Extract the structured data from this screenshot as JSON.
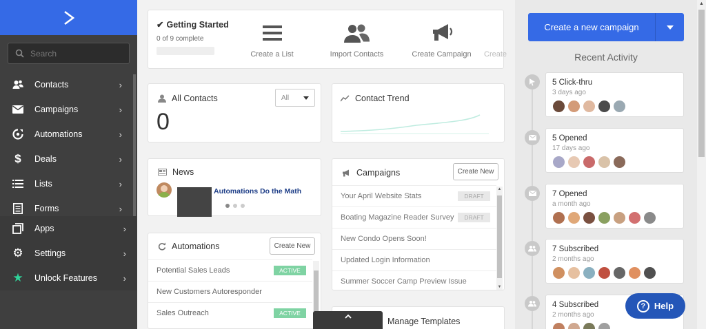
{
  "sidebar": {
    "search_placeholder": "Search",
    "nav": [
      {
        "label": "Contacts",
        "icon": "contacts-icon"
      },
      {
        "label": "Campaigns",
        "icon": "envelope-icon"
      },
      {
        "label": "Automations",
        "icon": "automation-icon"
      },
      {
        "label": "Deals",
        "icon": "dollar-icon"
      },
      {
        "label": "Lists",
        "icon": "list-icon"
      },
      {
        "label": "Forms",
        "icon": "form-icon"
      }
    ],
    "nav_lower": [
      {
        "label": "Apps",
        "icon": "apps-icon"
      },
      {
        "label": "Settings",
        "icon": "gear-icon"
      },
      {
        "label": "Unlock Features",
        "icon": "star-icon"
      }
    ]
  },
  "getting_started": {
    "title": "Getting Started",
    "progress": "0 of 9 complete",
    "steps": [
      "Create a List",
      "Import Contacts",
      "Create Campaign",
      "Create"
    ]
  },
  "all_contacts": {
    "title": "All Contacts",
    "filter": "All",
    "count": "0"
  },
  "contact_trend": {
    "title": "Contact Trend"
  },
  "news": {
    "title": "News",
    "link": "Automations Do the Math"
  },
  "campaigns": {
    "title": "Campaigns",
    "create_label": "Create New",
    "items": [
      {
        "name": "Your April Website Stats",
        "status": "DRAFT"
      },
      {
        "name": "Boating Magazine Reader Survey",
        "status": "DRAFT"
      },
      {
        "name": "New Condo Opens Soon!",
        "status": ""
      },
      {
        "name": "Updated Login Information",
        "status": ""
      },
      {
        "name": "Summer Soccer Camp Preview Issue",
        "status": ""
      }
    ]
  },
  "automations": {
    "title": "Automations",
    "create_label": "Create New",
    "items": [
      {
        "name": "Potential Sales Leads",
        "status": "ACTIVE"
      },
      {
        "name": "New Customers Autoresponder",
        "status": ""
      },
      {
        "name": "Sales Outreach",
        "status": "ACTIVE"
      }
    ]
  },
  "templates": {
    "title": "Manage Templates"
  },
  "right": {
    "create_button": "Create a new campaign",
    "recent_title": "Recent Activity",
    "activities": [
      {
        "title": "5 Click-thru",
        "date": "3 days ago",
        "icon": "cursor-icon",
        "avatars": 5
      },
      {
        "title": "5 Opened",
        "date": "17 days ago",
        "icon": "envelope-icon",
        "avatars": 5
      },
      {
        "title": "7 Opened",
        "date": "a month ago",
        "icon": "envelope-icon",
        "avatars": 7
      },
      {
        "title": "7 Subscribed",
        "date": "2 months ago",
        "icon": "users-icon",
        "avatars": 7
      },
      {
        "title": "4 Subscribed",
        "date": "2 months ago",
        "icon": "users-icon",
        "avatars": 4
      }
    ],
    "help_label": "Help"
  },
  "colors": {
    "brand": "#356ae6",
    "sidebar": "#3f3f3f",
    "active": "#7fd3a3",
    "help": "#2456b8"
  }
}
